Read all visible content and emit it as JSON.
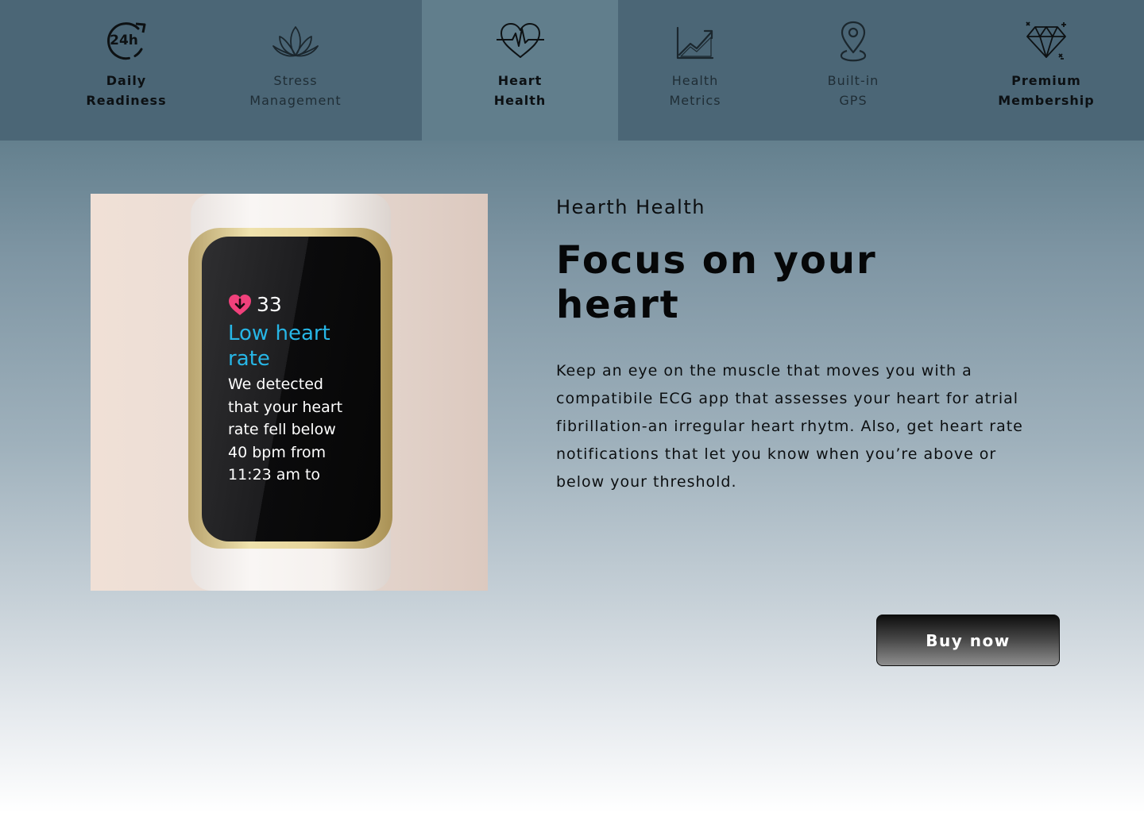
{
  "nav": {
    "items": [
      {
        "icon": "clock-24h-icon",
        "lines": [
          "Daily",
          "Readiness"
        ],
        "active": false
      },
      {
        "icon": "lotus-icon",
        "lines": [
          "Stress",
          "Management"
        ],
        "active": false
      },
      {
        "icon": "heart-pulse-icon",
        "lines": [
          "Heart",
          "Health"
        ],
        "active": true
      },
      {
        "icon": "trend-chart-icon",
        "lines": [
          "Health",
          "Metrics"
        ],
        "active": false
      },
      {
        "icon": "map-pin-icon",
        "lines": [
          "Built-in",
          "GPS"
        ],
        "active": false
      },
      {
        "icon": "diamond-icon",
        "lines": [
          "Premium",
          "Membership"
        ],
        "active": false
      }
    ],
    "icon_24h_text": "24h"
  },
  "colors": {
    "nav_bg": "#4b6676",
    "nav_active_bg": "#617e8c",
    "screen_accent": "#27b6e6",
    "heart_icon": "#f0417b"
  },
  "device_screen": {
    "heart_rate": "33",
    "alert_title": [
      "Low heart",
      "rate"
    ],
    "alert_body": [
      "We detected",
      "that your heart",
      "rate fell below",
      "40 bpm from",
      "11:23 am to"
    ]
  },
  "content": {
    "eyebrow": "Hearth Health",
    "headline": [
      "Focus on your",
      "heart"
    ],
    "description": [
      "Keep an eye on the muscle that moves you with a",
      "compatibile ECG app that assesses your heart for atrial",
      "fibrillation-an irregular heart rhytm. Also, get heart rate",
      "notifications that let you know when you’re above or",
      "below your threshold."
    ]
  },
  "cta": {
    "label": "Buy now"
  }
}
